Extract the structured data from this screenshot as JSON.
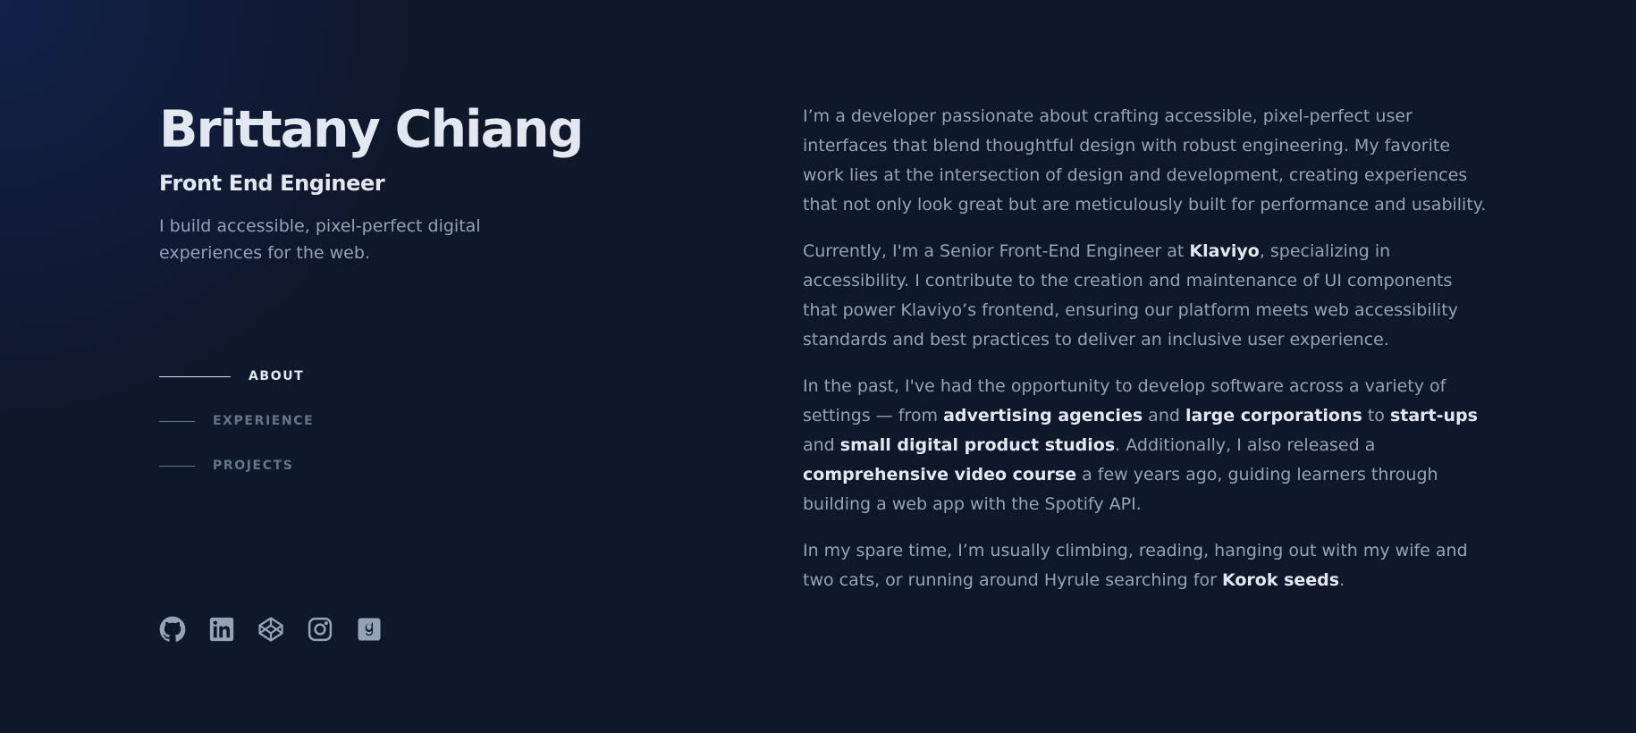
{
  "header": {
    "name": "Brittany Chiang",
    "role": "Front End Engineer",
    "tagline": "I build accessible, pixel-perfect digital experiences for the web."
  },
  "nav": {
    "items": [
      {
        "label": "ABOUT",
        "active": true
      },
      {
        "label": "EXPERIENCE",
        "active": false
      },
      {
        "label": "PROJECTS",
        "active": false
      }
    ]
  },
  "socials": [
    {
      "icon": "github-icon"
    },
    {
      "icon": "linkedin-icon"
    },
    {
      "icon": "codepen-icon"
    },
    {
      "icon": "instagram-icon"
    },
    {
      "icon": "goodreads-icon"
    }
  ],
  "about": {
    "p1": "I’m a developer passionate about crafting accessible, pixel-perfect user interfaces that blend thoughtful design with robust engineering. My favorite work lies at the intersection of design and development, creating experiences that not only look great but are meticulously built for performance and usability.",
    "p2": {
      "t1": "Currently, I'm a Senior Front-End Engineer at ",
      "link1": "Klaviyo",
      "t2": ", specializing in accessibility. I contribute to the creation and maintenance of UI components that power Klaviyo’s frontend, ensuring our platform meets web accessibility standards and best practices to deliver an inclusive user experience."
    },
    "p3": {
      "t1": "In the past, I've had the opportunity to develop software across a variety of settings — from ",
      "link1": "advertising agencies",
      "t2": " and ",
      "link2": "large corporations",
      "t3": " to ",
      "link3": "start-ups",
      "t4": " and ",
      "link4": "small digital product studios",
      "t5": ". Additionally, I also released a ",
      "link5": "comprehensive video course",
      "t6": " a few years ago, guiding learners through building a web app with the Spotify API."
    },
    "p4": {
      "t1": "In my spare time, I’m usually climbing, reading, hanging out with my wife and two cats, or running around Hyrule searching for ",
      "link1": "Korok seeds",
      "t2": "."
    }
  },
  "colors": {
    "background": "#0f172a",
    "heading": "#e2e8f0",
    "body": "#94a3b8",
    "muted": "#64748b"
  }
}
